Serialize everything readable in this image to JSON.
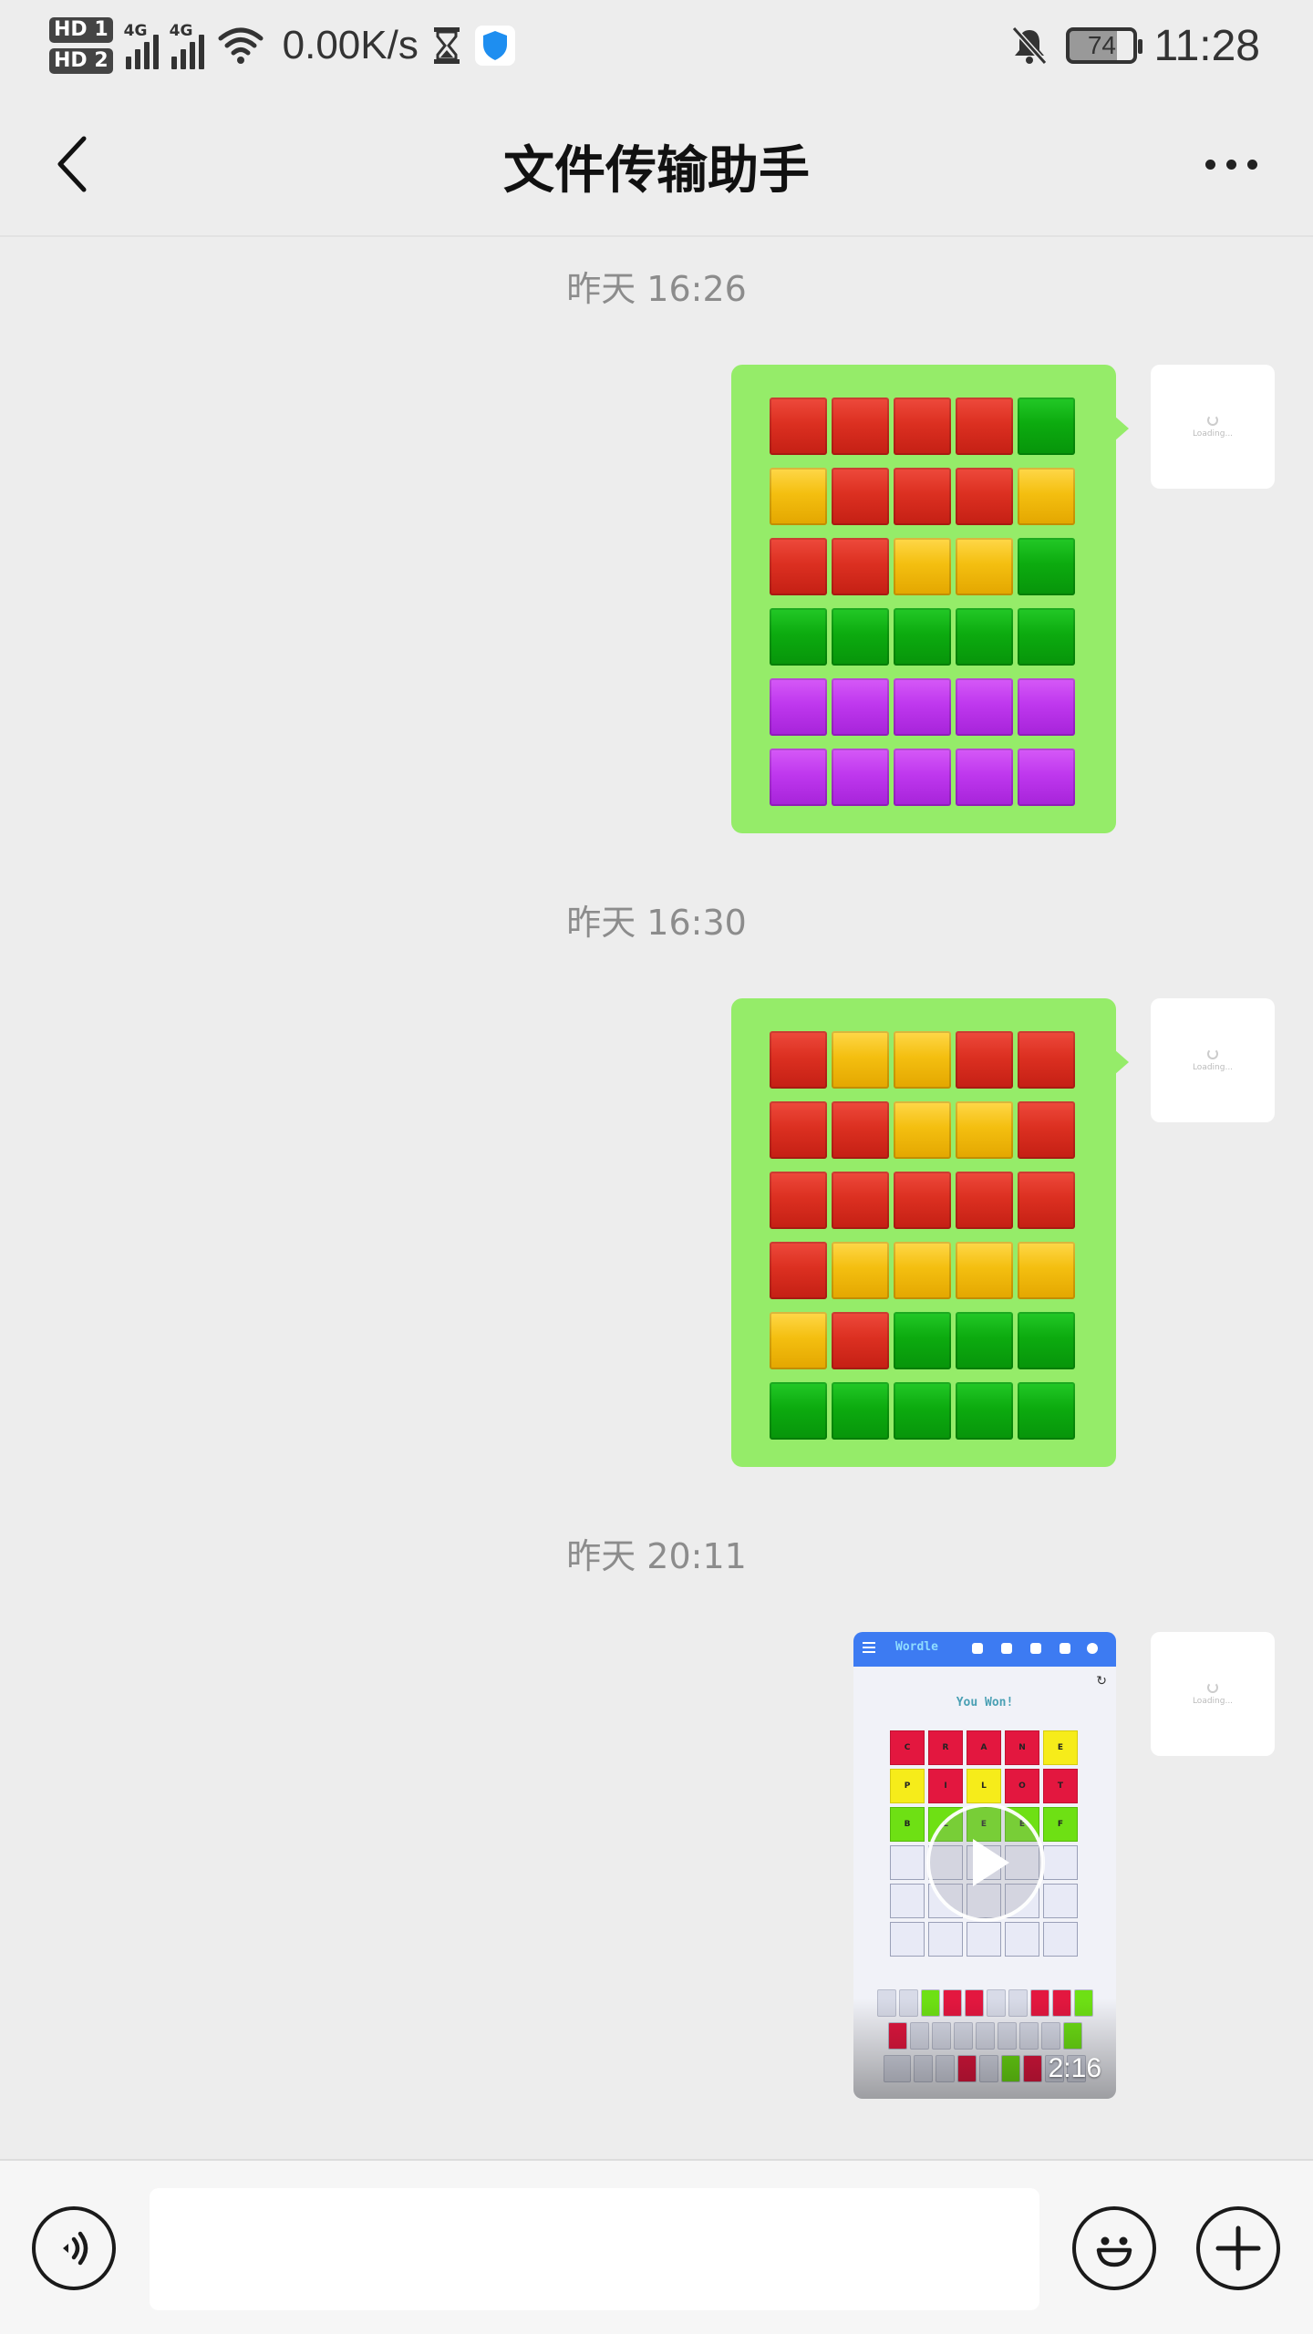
{
  "status_bar": {
    "sim1_label": "HD 1",
    "sim2_label": "HD 2",
    "network1": "4G",
    "network2": "4G",
    "speed": "0.00K/s",
    "battery": "74",
    "time": "11:28"
  },
  "nav": {
    "title": "文件传输助手",
    "back_icon": "chevron-left-icon",
    "more_icon": "more-dots-icon"
  },
  "messages": [
    {
      "timestamp": "昨天 16:26",
      "type": "text-emoji-grid",
      "grid": [
        [
          "r",
          "r",
          "r",
          "r",
          "g"
        ],
        [
          "y",
          "r",
          "r",
          "r",
          "y"
        ],
        [
          "r",
          "r",
          "y",
          "y",
          "g"
        ],
        [
          "g",
          "g",
          "g",
          "g",
          "g"
        ],
        [
          "p",
          "p",
          "p",
          "p",
          "p"
        ],
        [
          "p",
          "p",
          "p",
          "p",
          "p"
        ]
      ]
    },
    {
      "timestamp": "昨天 16:30",
      "type": "text-emoji-grid",
      "grid": [
        [
          "r",
          "y",
          "y",
          "r",
          "r"
        ],
        [
          "r",
          "r",
          "y",
          "y",
          "r"
        ],
        [
          "r",
          "r",
          "r",
          "r",
          "r"
        ],
        [
          "r",
          "y",
          "y",
          "y",
          "y"
        ],
        [
          "y",
          "r",
          "g",
          "g",
          "g"
        ],
        [
          "g",
          "g",
          "g",
          "g",
          "g"
        ]
      ]
    },
    {
      "timestamp": "昨天 20:11",
      "type": "video",
      "duration": "2:16",
      "preview": {
        "title": "Wordle",
        "message": "You Won!",
        "board": [
          [
            {
              "l": "C",
              "c": "r"
            },
            {
              "l": "R",
              "c": "r"
            },
            {
              "l": "A",
              "c": "r"
            },
            {
              "l": "N",
              "c": "r"
            },
            {
              "l": "E",
              "c": "y"
            }
          ],
          [
            {
              "l": "P",
              "c": "y"
            },
            {
              "l": "I",
              "c": "r"
            },
            {
              "l": "L",
              "c": "y"
            },
            {
              "l": "O",
              "c": "r"
            },
            {
              "l": "T",
              "c": "r"
            }
          ],
          [
            {
              "l": "B",
              "c": "g"
            },
            {
              "l": "L",
              "c": "g"
            },
            {
              "l": "E",
              "c": "g"
            },
            {
              "l": "E",
              "c": "g"
            },
            {
              "l": "F",
              "c": "g"
            }
          ],
          [
            {
              "l": "",
              "c": ""
            },
            {
              "l": "",
              "c": ""
            },
            {
              "l": "",
              "c": ""
            },
            {
              "l": "",
              "c": ""
            },
            {
              "l": "",
              "c": ""
            }
          ],
          [
            {
              "l": "",
              "c": ""
            },
            {
              "l": "",
              "c": ""
            },
            {
              "l": "",
              "c": ""
            },
            {
              "l": "",
              "c": ""
            },
            {
              "l": "",
              "c": ""
            }
          ],
          [
            {
              "l": "",
              "c": ""
            },
            {
              "l": "",
              "c": ""
            },
            {
              "l": "",
              "c": ""
            },
            {
              "l": "",
              "c": ""
            },
            {
              "l": "",
              "c": ""
            }
          ]
        ],
        "keyboard": [
          [
            "",
            "",
            "g",
            "r",
            "r",
            "",
            "",
            "r",
            "r",
            "g"
          ],
          [
            "r",
            "",
            "",
            "",
            "",
            "",
            "",
            "",
            "g"
          ],
          [
            "w",
            "",
            "",
            "r",
            "",
            "g",
            "r",
            "",
            ""
          ]
        ]
      }
    }
  ],
  "avatar": {
    "loading_text": "Loading..."
  },
  "input_bar": {
    "voice_icon": "voice-icon",
    "emoji_icon": "emoji-icon",
    "plus_icon": "plus-icon"
  },
  "colors": {
    "bubble": "#95ec69",
    "background": "#ededed",
    "red": "#dc3021",
    "yellow": "#f4bf10",
    "green": "#0cab0f",
    "purple": "#bf38ee"
  }
}
